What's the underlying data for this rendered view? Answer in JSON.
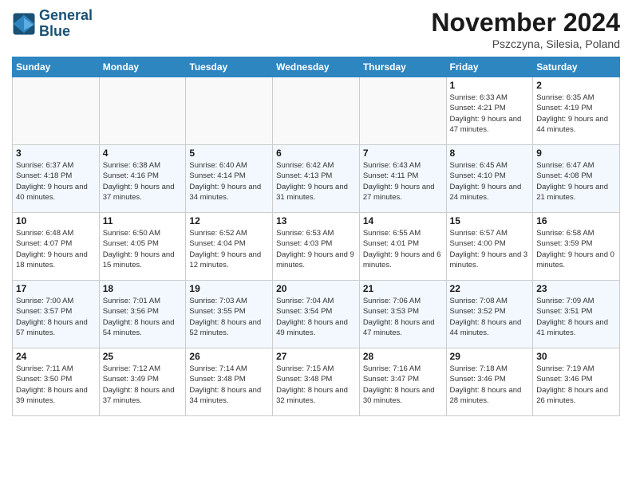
{
  "logo": {
    "line1": "General",
    "line2": "Blue"
  },
  "title": "November 2024",
  "subtitle": "Pszczyna, Silesia, Poland",
  "weekdays": [
    "Sunday",
    "Monday",
    "Tuesday",
    "Wednesday",
    "Thursday",
    "Friday",
    "Saturday"
  ],
  "weeks": [
    [
      {
        "day": "",
        "empty": true
      },
      {
        "day": "",
        "empty": true
      },
      {
        "day": "",
        "empty": true
      },
      {
        "day": "",
        "empty": true
      },
      {
        "day": "",
        "empty": true
      },
      {
        "day": "1",
        "sunrise": "6:33 AM",
        "sunset": "4:21 PM",
        "daylight": "9 hours and 47 minutes."
      },
      {
        "day": "2",
        "sunrise": "6:35 AM",
        "sunset": "4:19 PM",
        "daylight": "9 hours and 44 minutes."
      }
    ],
    [
      {
        "day": "3",
        "sunrise": "6:37 AM",
        "sunset": "4:18 PM",
        "daylight": "9 hours and 40 minutes."
      },
      {
        "day": "4",
        "sunrise": "6:38 AM",
        "sunset": "4:16 PM",
        "daylight": "9 hours and 37 minutes."
      },
      {
        "day": "5",
        "sunrise": "6:40 AM",
        "sunset": "4:14 PM",
        "daylight": "9 hours and 34 minutes."
      },
      {
        "day": "6",
        "sunrise": "6:42 AM",
        "sunset": "4:13 PM",
        "daylight": "9 hours and 31 minutes."
      },
      {
        "day": "7",
        "sunrise": "6:43 AM",
        "sunset": "4:11 PM",
        "daylight": "9 hours and 27 minutes."
      },
      {
        "day": "8",
        "sunrise": "6:45 AM",
        "sunset": "4:10 PM",
        "daylight": "9 hours and 24 minutes."
      },
      {
        "day": "9",
        "sunrise": "6:47 AM",
        "sunset": "4:08 PM",
        "daylight": "9 hours and 21 minutes."
      }
    ],
    [
      {
        "day": "10",
        "sunrise": "6:48 AM",
        "sunset": "4:07 PM",
        "daylight": "9 hours and 18 minutes."
      },
      {
        "day": "11",
        "sunrise": "6:50 AM",
        "sunset": "4:05 PM",
        "daylight": "9 hours and 15 minutes."
      },
      {
        "day": "12",
        "sunrise": "6:52 AM",
        "sunset": "4:04 PM",
        "daylight": "9 hours and 12 minutes."
      },
      {
        "day": "13",
        "sunrise": "6:53 AM",
        "sunset": "4:03 PM",
        "daylight": "9 hours and 9 minutes."
      },
      {
        "day": "14",
        "sunrise": "6:55 AM",
        "sunset": "4:01 PM",
        "daylight": "9 hours and 6 minutes."
      },
      {
        "day": "15",
        "sunrise": "6:57 AM",
        "sunset": "4:00 PM",
        "daylight": "9 hours and 3 minutes."
      },
      {
        "day": "16",
        "sunrise": "6:58 AM",
        "sunset": "3:59 PM",
        "daylight": "9 hours and 0 minutes."
      }
    ],
    [
      {
        "day": "17",
        "sunrise": "7:00 AM",
        "sunset": "3:57 PM",
        "daylight": "8 hours and 57 minutes."
      },
      {
        "day": "18",
        "sunrise": "7:01 AM",
        "sunset": "3:56 PM",
        "daylight": "8 hours and 54 minutes."
      },
      {
        "day": "19",
        "sunrise": "7:03 AM",
        "sunset": "3:55 PM",
        "daylight": "8 hours and 52 minutes."
      },
      {
        "day": "20",
        "sunrise": "7:04 AM",
        "sunset": "3:54 PM",
        "daylight": "8 hours and 49 minutes."
      },
      {
        "day": "21",
        "sunrise": "7:06 AM",
        "sunset": "3:53 PM",
        "daylight": "8 hours and 47 minutes."
      },
      {
        "day": "22",
        "sunrise": "7:08 AM",
        "sunset": "3:52 PM",
        "daylight": "8 hours and 44 minutes."
      },
      {
        "day": "23",
        "sunrise": "7:09 AM",
        "sunset": "3:51 PM",
        "daylight": "8 hours and 41 minutes."
      }
    ],
    [
      {
        "day": "24",
        "sunrise": "7:11 AM",
        "sunset": "3:50 PM",
        "daylight": "8 hours and 39 minutes."
      },
      {
        "day": "25",
        "sunrise": "7:12 AM",
        "sunset": "3:49 PM",
        "daylight": "8 hours and 37 minutes."
      },
      {
        "day": "26",
        "sunrise": "7:14 AM",
        "sunset": "3:48 PM",
        "daylight": "8 hours and 34 minutes."
      },
      {
        "day": "27",
        "sunrise": "7:15 AM",
        "sunset": "3:48 PM",
        "daylight": "8 hours and 32 minutes."
      },
      {
        "day": "28",
        "sunrise": "7:16 AM",
        "sunset": "3:47 PM",
        "daylight": "8 hours and 30 minutes."
      },
      {
        "day": "29",
        "sunrise": "7:18 AM",
        "sunset": "3:46 PM",
        "daylight": "8 hours and 28 minutes."
      },
      {
        "day": "30",
        "sunrise": "7:19 AM",
        "sunset": "3:46 PM",
        "daylight": "8 hours and 26 minutes."
      }
    ]
  ]
}
